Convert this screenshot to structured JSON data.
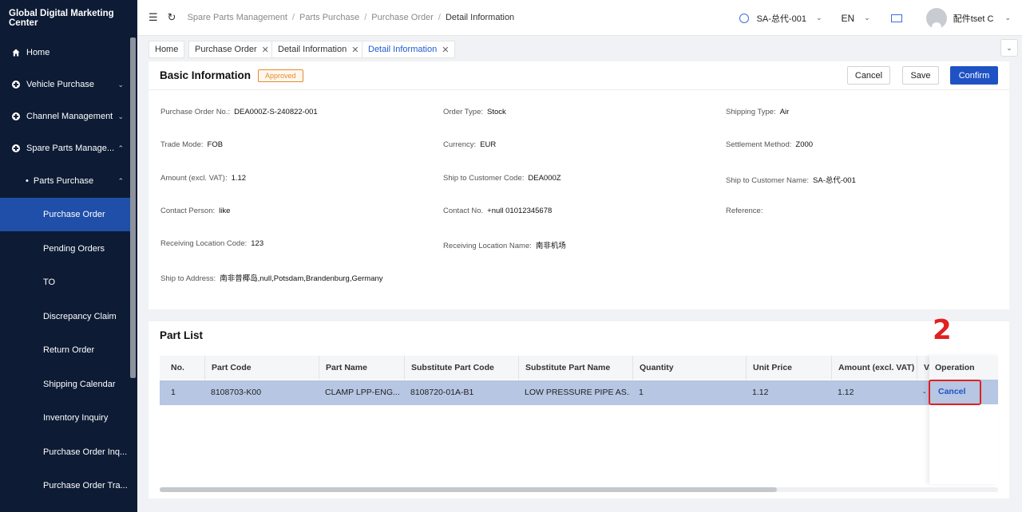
{
  "app": {
    "title": "Global Digital Marketing Center"
  },
  "sidebar": {
    "items": [
      {
        "label": "Home",
        "icon": "home-icon",
        "chevron": ""
      },
      {
        "label": "Vehicle Purchase",
        "icon": "plus-circle-icon",
        "chevron": "⌄"
      },
      {
        "label": "Channel Management",
        "icon": "plus-circle-icon",
        "chevron": "⌄"
      },
      {
        "label": "Spare Parts Manage...",
        "icon": "plus-circle-icon",
        "chevron": "⌃"
      },
      {
        "label": "Parts Purchase",
        "icon": "bullet-icon",
        "chevron": "⌃"
      },
      {
        "label": "Purchase Order"
      },
      {
        "label": "Pending Orders"
      },
      {
        "label": "TO"
      },
      {
        "label": "Discrepancy Claim"
      },
      {
        "label": "Return Order"
      },
      {
        "label": "Shipping Calendar"
      },
      {
        "label": "Inventory Inquiry"
      },
      {
        "label": "Purchase Order Inq..."
      },
      {
        "label": "Purchase Order Tra..."
      }
    ]
  },
  "topbar": {
    "breadcrumb": [
      "Spare Parts Management",
      "Parts Purchase",
      "Purchase Order",
      "Detail Information"
    ],
    "account": "SA-总代-001",
    "language": "EN",
    "username": "配件tset C"
  },
  "tabs": [
    {
      "label": "Home",
      "closable": false
    },
    {
      "label": "Purchase Order",
      "closable": true
    },
    {
      "label": "Detail Information",
      "closable": true
    },
    {
      "label": "Detail Information",
      "closable": true
    }
  ],
  "basic": {
    "title": "Basic Information",
    "status": "Approved",
    "buttons": {
      "cancel": "Cancel",
      "save": "Save",
      "confirm": "Confirm"
    },
    "fields": [
      {
        "label": "Purchase Order No.:",
        "value": "DEA000Z-S-240822-001"
      },
      {
        "label": "Order Type:",
        "value": "Stock"
      },
      {
        "label": "Shipping Type:",
        "value": "Air"
      },
      {
        "label": "Trade Mode:",
        "value": "FOB"
      },
      {
        "label": "Currency:",
        "value": "EUR"
      },
      {
        "label": "Settlement Method:",
        "value": "Z000"
      },
      {
        "label": "Amount (excl. VAT):",
        "value": "1.12"
      },
      {
        "label": "Ship to Customer Code:",
        "value": "DEA000Z"
      },
      {
        "label": "Ship to Customer Name:",
        "value": "SA-总代-001"
      },
      {
        "label": "Contact Person:",
        "value": "like"
      },
      {
        "label": "Contact No.",
        "value": "+null 01012345678"
      },
      {
        "label": "Reference:",
        "value": ""
      },
      {
        "label": "Receiving Location Code:",
        "value": "123"
      },
      {
        "label": "Receiving Location Name:",
        "value": "南非机场"
      },
      {
        "label": "Ship to Address:",
        "value": "南非普椰岛,null,Potsdam,Brandenburg,Germany"
      }
    ]
  },
  "parts": {
    "title": "Part List",
    "columns": [
      "No.",
      "Part Code",
      "Part Name",
      "Substitute Part Code",
      "Substitute Part Name",
      "Quantity",
      "Unit Price",
      "Amount (excl. VAT)",
      "Va",
      "Operation"
    ],
    "rows": [
      {
        "no": "1",
        "part_code": "8108703-K00",
        "part_name": "CLAMP LPP-ENG...",
        "sub_code": "8108720-01A-B1",
        "sub_name": "LOW PRESSURE PIPE AS...",
        "quantity": "1",
        "unit_price": "1.12",
        "amount": "1.12",
        "va": "-",
        "operation": "Cancel"
      }
    ]
  },
  "annotation": {
    "step": "2"
  }
}
